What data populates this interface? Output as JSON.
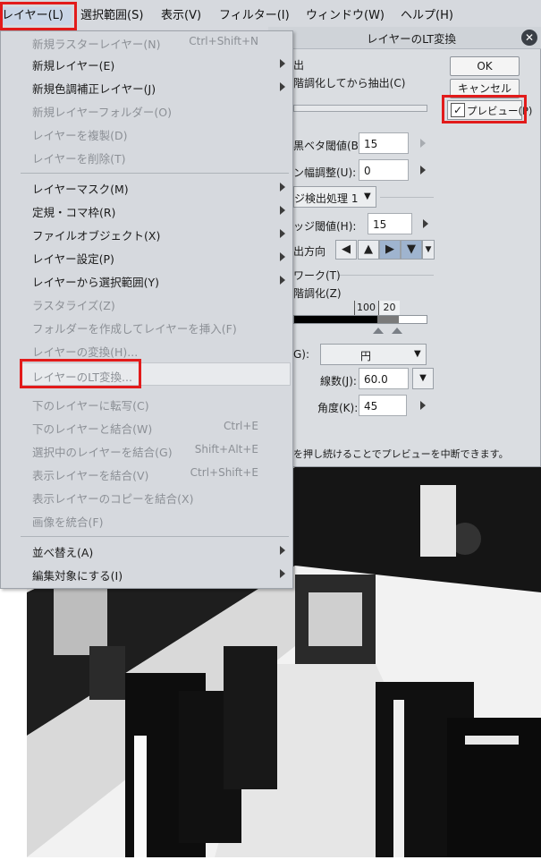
{
  "menubar": {
    "items": [
      {
        "label": "レイヤー(L)"
      },
      {
        "label": "選択範囲(S)"
      },
      {
        "label": "表示(V)"
      },
      {
        "label": "フィルター(I)"
      },
      {
        "label": "ウィンドウ(W)"
      },
      {
        "label": "ヘルプ(H)"
      }
    ]
  },
  "menu": {
    "items": [
      {
        "label": "新規ラスターレイヤー(N)",
        "shortcut": "Ctrl+Shift+N",
        "enabled": false
      },
      {
        "label": "新規レイヤー(E)",
        "submenu": true,
        "enabled": true
      },
      {
        "label": "新規色調補正レイヤー(J)",
        "submenu": true,
        "enabled": true
      },
      {
        "label": "新規レイヤーフォルダー(O)",
        "enabled": false
      },
      {
        "label": "レイヤーを複製(D)",
        "enabled": false
      },
      {
        "label": "レイヤーを削除(T)",
        "enabled": false
      },
      {
        "label": "レイヤーマスク(M)",
        "submenu": true,
        "enabled": true
      },
      {
        "label": "定規・コマ枠(R)",
        "submenu": true,
        "enabled": true
      },
      {
        "label": "ファイルオブジェクト(X)",
        "submenu": true,
        "enabled": true
      },
      {
        "label": "レイヤー設定(P)",
        "submenu": true,
        "enabled": true
      },
      {
        "label": "レイヤーから選択範囲(Y)",
        "submenu": true,
        "enabled": true
      },
      {
        "label": "ラスタライズ(Z)",
        "enabled": false
      },
      {
        "label": "フォルダーを作成してレイヤーを挿入(F)",
        "enabled": false
      },
      {
        "label": "レイヤーの変換(H)...",
        "enabled": false
      },
      {
        "label": "レイヤーのLT変換...",
        "enabled": false,
        "highlighted": true
      },
      {
        "label": "下のレイヤーに転写(C)",
        "enabled": false
      },
      {
        "label": "下のレイヤーと結合(W)",
        "shortcut": "Ctrl+E",
        "enabled": false
      },
      {
        "label": "選択中のレイヤーを結合(G)",
        "shortcut": "Shift+Alt+E",
        "enabled": false
      },
      {
        "label": "表示レイヤーを結合(V)",
        "shortcut": "Ctrl+Shift+E",
        "enabled": false
      },
      {
        "label": "表示レイヤーのコピーを結合(X)",
        "enabled": false
      },
      {
        "label": "画像を統合(F)",
        "enabled": false
      },
      {
        "label": "並べ替え(A)",
        "submenu": true,
        "enabled": true
      },
      {
        "label": "編集対象にする(I)",
        "submenu": true,
        "enabled": true
      }
    ]
  },
  "dialog": {
    "title": "レイヤーのLT変換",
    "close_glyph": "✕",
    "ok_label": "OK",
    "cancel_label": "キャンセル",
    "preview_label": "プレビュー(P)",
    "preview_checked": true,
    "checkmark": "✓",
    "frag_extract": "出",
    "frag_extract_opt": "階調化してから抽出(C)",
    "frag_threshold_label": "黒ベタ閾値(B)",
    "threshold_value": "15",
    "frag_width_label": "ン幅調整(U):",
    "width_value": "0",
    "frag_edge_proc": "ジ検出処理 1",
    "frag_edge_thresh_label": "ッジ閾値(H):",
    "edge_thresh_value": "15",
    "frag_direction_label": "出方向",
    "dir_arrows": [
      "◀",
      "▲",
      "▶",
      "▼"
    ],
    "dropdown_glyph": "▼",
    "frag_tone_work": "ワーク(T)",
    "frag_tone_levels": "階調化(Z)",
    "slider_low": "100",
    "slider_high": "20",
    "frag_shape_label": "G):",
    "shape_value": "円",
    "lines_label": "線数(J):",
    "lines_value": "60.0",
    "angle_label": "角度(K):",
    "angle_value": "45",
    "hint": "を押し続けることでプレビューを中断できます。"
  },
  "colors": {
    "highlight": "#e21b1b",
    "menu_bg": "#d6d9de",
    "dialog_bg": "#dadde1"
  }
}
